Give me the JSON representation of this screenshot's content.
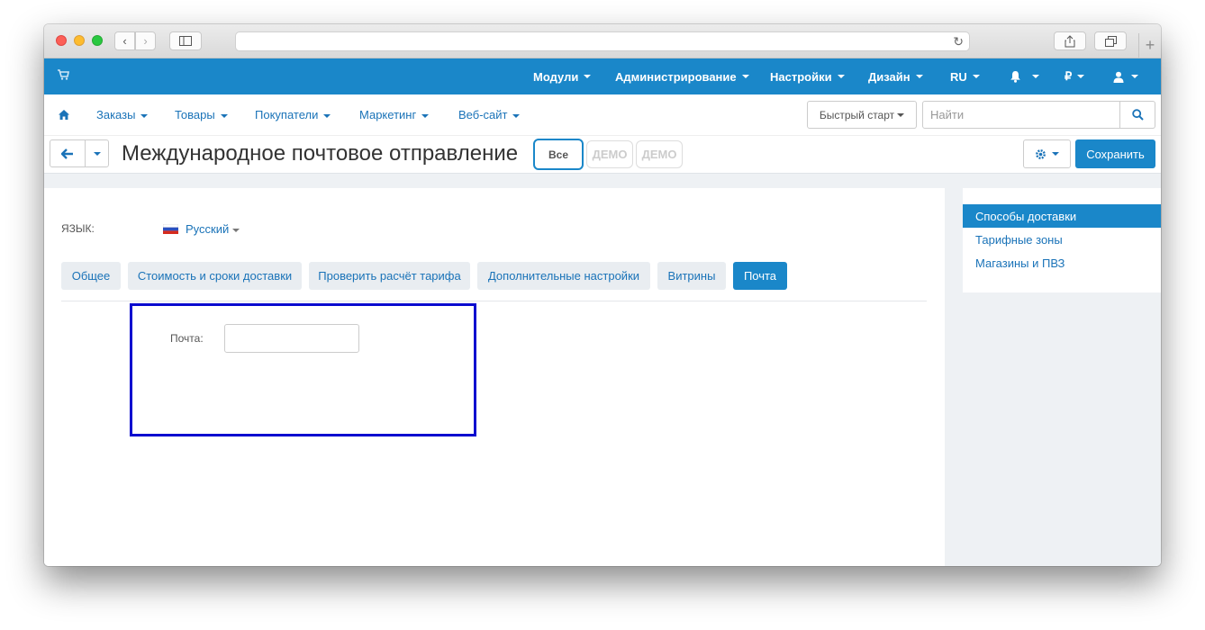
{
  "topbar": {
    "items": [
      {
        "label": "Модули"
      },
      {
        "label": "Администрирование"
      },
      {
        "label": "Настройки"
      },
      {
        "label": "Дизайн"
      },
      {
        "label": "RU"
      },
      {
        "label": ""
      },
      {
        "label": "₽"
      },
      {
        "label": ""
      }
    ]
  },
  "nav": {
    "items": [
      {
        "label": "Заказы"
      },
      {
        "label": "Товары"
      },
      {
        "label": "Покупатели"
      },
      {
        "label": "Маркетинг"
      },
      {
        "label": "Веб-сайт"
      }
    ],
    "quick_start": "Быстрый старт",
    "search_placeholder": "Найти"
  },
  "titlebar": {
    "title": "Международное почтовое отправление",
    "filter_all": "Все",
    "demo1": "ДЕМО",
    "demo2": "ДЕМО",
    "save": "Сохранить"
  },
  "form": {
    "lang_label": "ЯЗЫК:",
    "lang_value": "Русский",
    "tabs": [
      {
        "label": "Общее"
      },
      {
        "label": "Стоимость и сроки доставки"
      },
      {
        "label": "Проверить расчёт тарифа"
      },
      {
        "label": "Дополнительные настройки"
      },
      {
        "label": "Витрины"
      },
      {
        "label": "Почта"
      }
    ],
    "mail_label": "Почта:",
    "mail_value": ""
  },
  "sidebar": {
    "items": [
      {
        "label": "Способы доставки"
      },
      {
        "label": "Тарифные зоны"
      },
      {
        "label": "Магазины и ПВЗ"
      }
    ]
  },
  "colors": {
    "brand": "#1a87c9",
    "highlight": "#0a0acf"
  }
}
